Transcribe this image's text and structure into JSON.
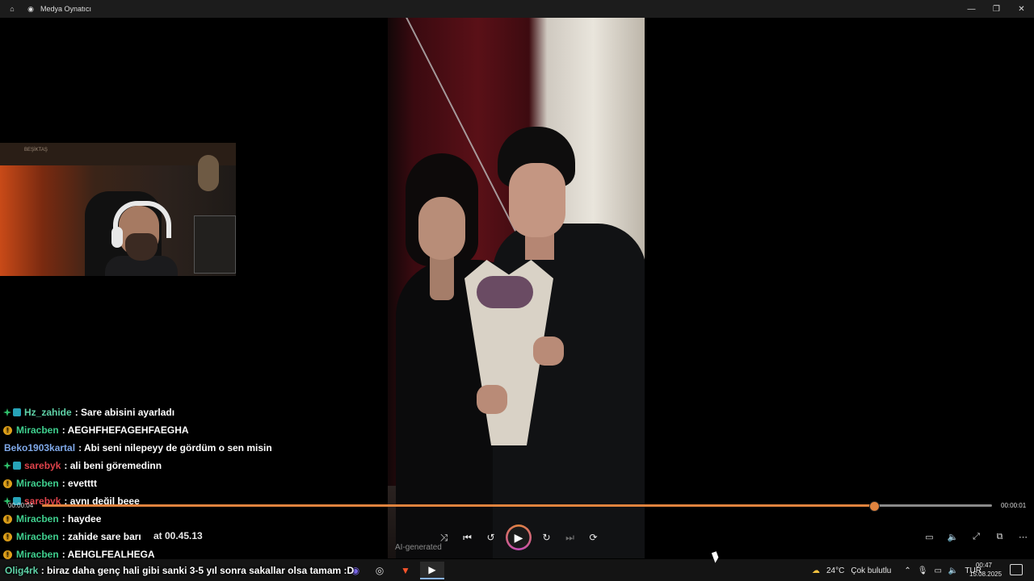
{
  "window": {
    "title": "Medya Oynatıcı",
    "home_icon": "home-icon",
    "app_icon": "media-player-icon",
    "controls": [
      "minimize-icon",
      "restore-icon",
      "close-icon"
    ]
  },
  "webcam": {
    "shelf_text": "BEŞİKTAŞ"
  },
  "chat": [
    {
      "user": "Hz_zahide",
      "badge": "sub",
      "user_color": "#5fd3a8",
      "message": "Sare abisini ayarladı"
    },
    {
      "user": "Miracben",
      "badge": "coin",
      "user_color": "#3fcf8e",
      "message": "AEGHFHEFAGEHFAEGHA"
    },
    {
      "user": "Beko1903kartal",
      "badge": "none",
      "user_color": "#7fa8e8",
      "message": "Abi seni nilepeyy de gördüm o sen misin"
    },
    {
      "user": "sarebyk",
      "badge": "sub",
      "user_color": "#e0434b",
      "message": "ali beni göremedinn"
    },
    {
      "user": "Miracben",
      "badge": "coin",
      "user_color": "#3fcf8e",
      "message": "evetttt"
    },
    {
      "user": "sarebyk",
      "badge": "sub",
      "user_color": "#e0434b",
      "message": "aynı değil beee"
    },
    {
      "user": "Miracben",
      "badge": "coin",
      "user_color": "#3fcf8e",
      "message": "haydee"
    },
    {
      "user": "Miracben",
      "badge": "coin",
      "user_color": "#3fcf8e",
      "message": "zahide sare barı"
    },
    {
      "user": "Miracben",
      "badge": "coin",
      "user_color": "#3fcf8e",
      "message": "AEHGLFEALHEGA"
    }
  ],
  "chat_system_overlay": "at 00.45.13",
  "bottom_message": {
    "user": "Olig4rk",
    "message": "biraz daha genç hali gibi sanki 3-5 yıl sonra sakallar olsa tamam :D"
  },
  "player": {
    "time_elapsed": "00:00:04",
    "time_total": "00:00:01",
    "progress_fraction": 0.875,
    "ai_label": "AI-generated",
    "accent_color": "#e0833e",
    "buttons": [
      {
        "name": "shuffle",
        "icon": "shuffle-icon",
        "glyph": "⤨",
        "dim": false
      },
      {
        "name": "previous",
        "icon": "previous-icon",
        "glyph": "⏮",
        "dim": false
      },
      {
        "name": "rewind-10",
        "icon": "rewind-icon",
        "glyph": "↺",
        "dim": false
      },
      {
        "name": "play",
        "icon": "play-icon",
        "glyph": "▶",
        "dim": false
      },
      {
        "name": "forward-30",
        "icon": "forward-icon",
        "glyph": "↻",
        "dim": false
      },
      {
        "name": "next",
        "icon": "next-icon",
        "glyph": "⏭",
        "dim": true
      },
      {
        "name": "repeat",
        "icon": "repeat-icon",
        "glyph": "⟳",
        "dim": false
      }
    ],
    "right_buttons": [
      {
        "name": "subtitles",
        "icon": "subtitles-icon",
        "glyph": "▭"
      },
      {
        "name": "volume",
        "icon": "volume-icon",
        "glyph": "🔈"
      },
      {
        "name": "fullscreen",
        "icon": "fullscreen-icon",
        "glyph": "⤢"
      },
      {
        "name": "mini-player",
        "icon": "mini-player-icon",
        "glyph": "⧉"
      },
      {
        "name": "more",
        "icon": "more-icon",
        "glyph": "⋯"
      }
    ]
  },
  "taskbar": {
    "apps": [
      {
        "icon": "discord-icon",
        "glyph": "◉",
        "color": "#7b68ee"
      },
      {
        "icon": "obs-icon",
        "glyph": "◎",
        "color": "#dddddd"
      },
      {
        "icon": "brave-icon",
        "glyph": "▼",
        "color": "#fb542b"
      },
      {
        "icon": "media-player-icon",
        "glyph": "▶",
        "color": "#ffffff",
        "active": true
      }
    ],
    "weather_temp": "24°C",
    "weather_text": "Çok bulutlu",
    "language": "TUR",
    "time": "00:47",
    "date": "15.08.2025"
  }
}
